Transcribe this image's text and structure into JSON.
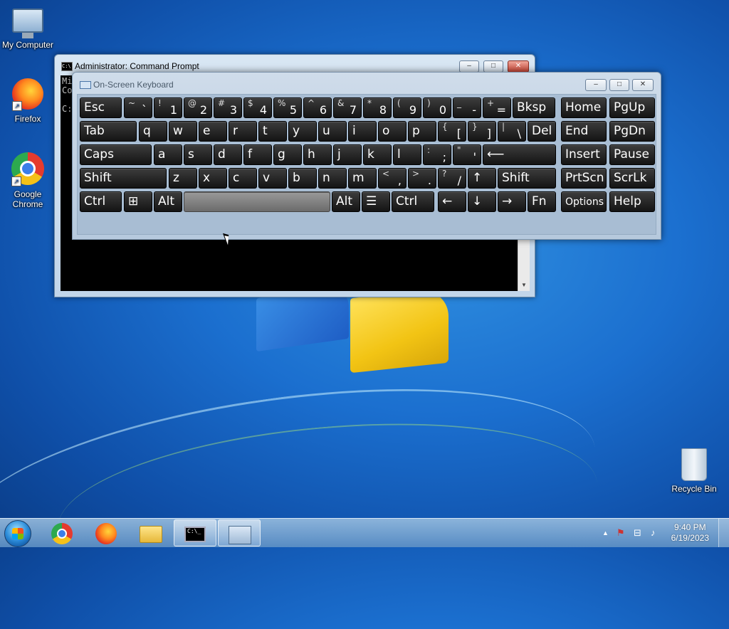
{
  "desktop": {
    "icons": [
      {
        "label": "My Computer",
        "icon": "computer-icon"
      },
      {
        "label": "Firefox",
        "icon": "firefox-icon"
      },
      {
        "label": "Google Chrome",
        "icon": "chrome-icon"
      },
      {
        "label": "Recycle Bin",
        "icon": "recycle-bin-icon"
      }
    ]
  },
  "cmd_window": {
    "title": "Administrator:  Command Prompt",
    "console_lines": [
      "Mi",
      "Co",
      "",
      "C:"
    ],
    "buttons": {
      "minimize": "–",
      "maximize": "□",
      "close": "✕"
    }
  },
  "osk": {
    "title": "On-Screen Keyboard",
    "buttons": {
      "minimize": "–",
      "maximize": "□",
      "close": "✕"
    },
    "rows": [
      [
        {
          "main": "Esc"
        },
        {
          "top": "~",
          "bot": "`"
        },
        {
          "top": "!",
          "bot": "1"
        },
        {
          "top": "@",
          "bot": "2"
        },
        {
          "top": "#",
          "bot": "3"
        },
        {
          "top": "$",
          "bot": "4"
        },
        {
          "top": "%",
          "bot": "5"
        },
        {
          "top": "^",
          "bot": "6"
        },
        {
          "top": "&",
          "bot": "7"
        },
        {
          "top": "*",
          "bot": "8"
        },
        {
          "top": "(",
          "bot": "9"
        },
        {
          "top": ")",
          "bot": "0"
        },
        {
          "top": "_",
          "bot": "-"
        },
        {
          "top": "+",
          "bot": "="
        },
        {
          "main": "Bksp"
        },
        {
          "main": "Home"
        },
        {
          "main": "PgUp"
        }
      ],
      [
        {
          "main": "Tab"
        },
        {
          "main": "q"
        },
        {
          "main": "w"
        },
        {
          "main": "e"
        },
        {
          "main": "r"
        },
        {
          "main": "t"
        },
        {
          "main": "y"
        },
        {
          "main": "u"
        },
        {
          "main": "i"
        },
        {
          "main": "o"
        },
        {
          "main": "p"
        },
        {
          "top": "{",
          "bot": "["
        },
        {
          "top": "}",
          "bot": "]"
        },
        {
          "top": "|",
          "bot": "\\"
        },
        {
          "main": "Del"
        },
        {
          "main": "End"
        },
        {
          "main": "PgDn"
        }
      ],
      [
        {
          "main": "Caps"
        },
        {
          "main": "a"
        },
        {
          "main": "s"
        },
        {
          "main": "d"
        },
        {
          "main": "f"
        },
        {
          "main": "g"
        },
        {
          "main": "h"
        },
        {
          "main": "j"
        },
        {
          "main": "k"
        },
        {
          "main": "l"
        },
        {
          "top": ":",
          "bot": ";"
        },
        {
          "top": "\"",
          "bot": "'"
        },
        {
          "main": "⟵"
        },
        {
          "main": "Insert"
        },
        {
          "main": "Pause"
        }
      ],
      [
        {
          "main": "Shift"
        },
        {
          "main": "z"
        },
        {
          "main": "x"
        },
        {
          "main": "c"
        },
        {
          "main": "v"
        },
        {
          "main": "b"
        },
        {
          "main": "n"
        },
        {
          "main": "m"
        },
        {
          "top": "<",
          "bot": ","
        },
        {
          "top": ">",
          "bot": "."
        },
        {
          "top": "?",
          "bot": "/"
        },
        {
          "main": "↑"
        },
        {
          "main": "Shift"
        },
        {
          "main": "PrtScn"
        },
        {
          "main": "ScrLk"
        }
      ],
      [
        {
          "main": "Ctrl"
        },
        {
          "main": "⊞"
        },
        {
          "main": "Alt"
        },
        {
          "main": ""
        },
        {
          "main": "Alt"
        },
        {
          "main": "☰"
        },
        {
          "main": "Ctrl"
        },
        {
          "main": "←"
        },
        {
          "main": "↓"
        },
        {
          "main": "→"
        },
        {
          "main": "Fn"
        },
        {
          "main": "Options"
        },
        {
          "main": "Help"
        }
      ]
    ]
  },
  "taskbar": {
    "start_icon": "windows-start-icon",
    "pinned": [
      "chrome-icon",
      "firefox-icon",
      "folder-icon",
      "cmd-icon",
      "osk-icon"
    ],
    "tray": {
      "chevron": "▲",
      "flag": "⚑",
      "network": "⊟",
      "volume": "♪",
      "time": "9:40 PM",
      "date": "6/19/2023"
    }
  }
}
